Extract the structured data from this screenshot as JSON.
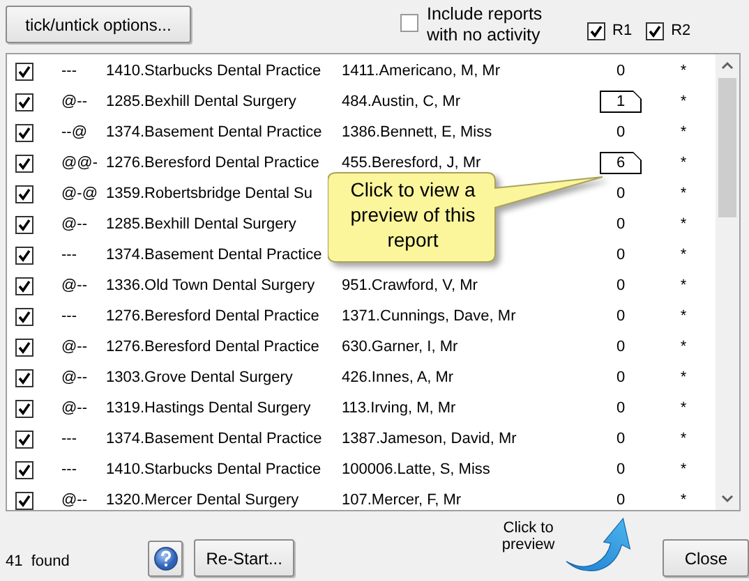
{
  "toolbar": {
    "options_button": "tick/untick options...",
    "include_inactive": {
      "label": "Include reports with no activity",
      "checked": false
    },
    "r1": {
      "label": "R1",
      "checked": true
    },
    "r2": {
      "label": "R2",
      "checked": true
    }
  },
  "rows": [
    {
      "checked": true,
      "code": "---",
      "practice": "1410.Starbucks Dental Practice",
      "person": "1411.Americano, M, Mr",
      "count": "0",
      "kind": "plain",
      "r2": "*"
    },
    {
      "checked": true,
      "code": "@--",
      "practice": "1285.Bexhill Dental Surgery",
      "person": "484.Austin, C, Mr",
      "count": "1",
      "kind": "preview",
      "r2": "*"
    },
    {
      "checked": true,
      "code": "--@",
      "practice": "1374.Basement Dental Practice",
      "person": "1386.Bennett, E, Miss",
      "count": "0",
      "kind": "plain",
      "r2": "*"
    },
    {
      "checked": true,
      "code": "@@-",
      "practice": "1276.Beresford Dental Practice",
      "person": "455.Beresford, J, Mr",
      "count": "6",
      "kind": "preview",
      "r2": "*"
    },
    {
      "checked": true,
      "code": "@-@",
      "practice": "1359.Robertsbridge Dental Su",
      "count": "0",
      "kind": "plain",
      "r2": "*"
    },
    {
      "checked": true,
      "code": "@--",
      "practice": "1285.Bexhill Dental Surgery",
      "count": "0",
      "kind": "plain",
      "r2": "*"
    },
    {
      "checked": true,
      "code": "---",
      "practice": "1374.Basement Dental Practice",
      "count": "0",
      "kind": "plain",
      "r2": "*"
    },
    {
      "checked": true,
      "code": "@--",
      "practice": "1336.Old Town Dental Surgery",
      "person": "951.Crawford, V, Mr",
      "count": "0",
      "kind": "plain",
      "r2": "*"
    },
    {
      "checked": true,
      "code": "---",
      "practice": "1276.Beresford Dental Practice",
      "person": "1371.Cunnings, Dave, Mr",
      "count": "0",
      "kind": "plain",
      "r2": "*"
    },
    {
      "checked": true,
      "code": "@--",
      "practice": "1276.Beresford Dental Practice",
      "person": "630.Garner, I, Mr",
      "count": "0",
      "kind": "plain",
      "r2": "*"
    },
    {
      "checked": true,
      "code": "@--",
      "practice": "1303.Grove Dental Surgery",
      "person": "426.Innes, A, Mr",
      "count": "0",
      "kind": "plain",
      "r2": "*"
    },
    {
      "checked": true,
      "code": "@--",
      "practice": "1319.Hastings Dental Surgery",
      "person": "113.Irving, M, Mr",
      "count": "0",
      "kind": "plain",
      "r2": "*"
    },
    {
      "checked": true,
      "code": "---",
      "practice": "1374.Basement Dental Practice",
      "person": "1387.Jameson, David, Mr",
      "count": "0",
      "kind": "plain",
      "r2": "*"
    },
    {
      "checked": true,
      "code": "---",
      "practice": "1410.Starbucks Dental Practice",
      "person": "100006.Latte, S, Miss",
      "count": "0",
      "kind": "plain",
      "r2": "*"
    },
    {
      "checked": true,
      "code": "@--",
      "practice": "1320.Mercer Dental Surgery",
      "person": "107.Mercer, F, Mr",
      "count": "0",
      "kind": "plain",
      "r2": "*"
    }
  ],
  "tooltip": "Click to view a preview of this report",
  "footer": {
    "found": "41  found",
    "restart_button": "Re-Start...",
    "hint": "Click to preview",
    "close_button": "Close"
  }
}
